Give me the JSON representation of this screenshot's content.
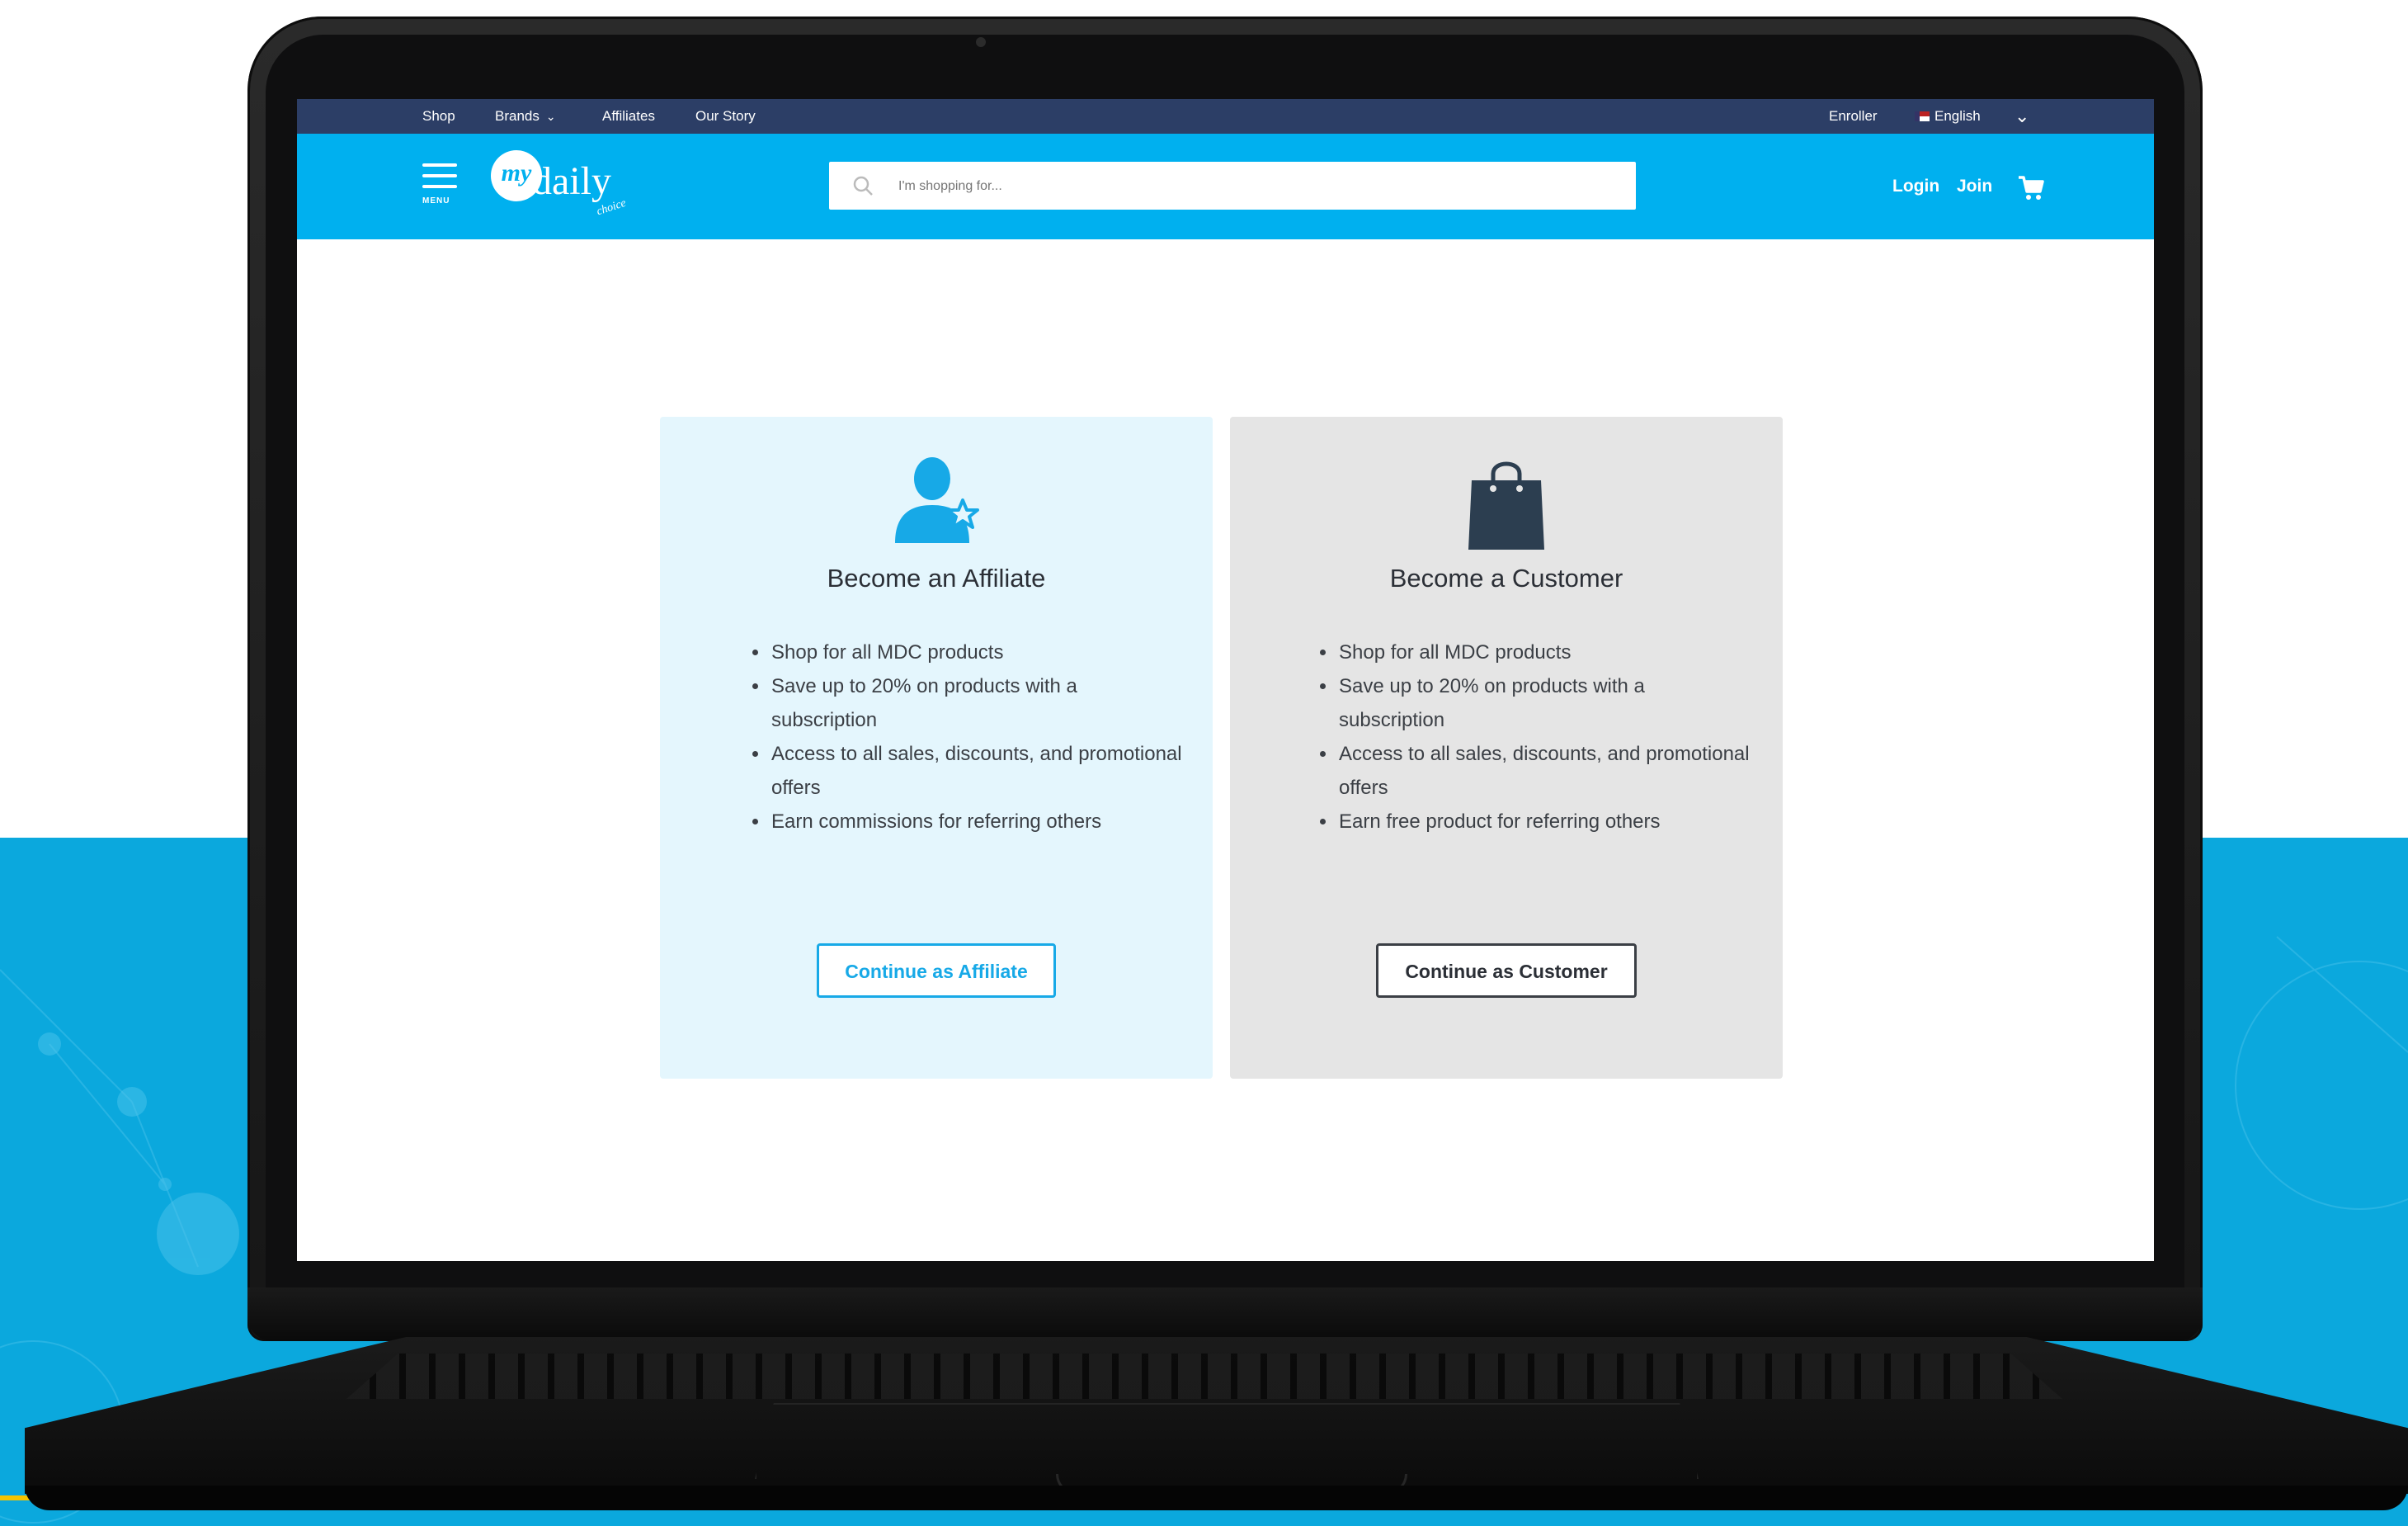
{
  "topnav": {
    "shop": "Shop",
    "brands": "Brands",
    "affiliates": "Affiliates",
    "our_story": "Our Story",
    "enroller": "Enroller",
    "language": "English"
  },
  "header": {
    "menu_label": "MENU",
    "logo": {
      "mark": "my",
      "word": "daily",
      "sub": "choice"
    },
    "search_placeholder": "I'm shopping for...",
    "login": "Login",
    "join": "Join"
  },
  "cards": [
    {
      "title": "Become an Affiliate",
      "icon": "affiliate-person-star-icon",
      "benefits": [
        "Shop for all MDC products",
        "Save up to 20% on products with a subscription",
        "Access to all sales, discounts, and promotional offers",
        "Earn commissions for referring others"
      ],
      "button": "Continue as Affiliate"
    },
    {
      "title": "Become a Customer",
      "icon": "shopping-bag-icon",
      "benefits": [
        "Shop for all MDC products",
        "Save up to 20% on products with a subscription",
        "Access to all sales, discounts, and promotional offers",
        "Earn free product for referring others"
      ],
      "button": "Continue as Customer"
    }
  ],
  "colors": {
    "brand_blue": "#00b0ef",
    "topbar_navy": "#2c3e66",
    "affiliate_bg": "#e4f6fd",
    "customer_bg": "#e5e5e5",
    "affiliate_accent": "#17a9e7",
    "icon_dark": "#2c3e50"
  }
}
